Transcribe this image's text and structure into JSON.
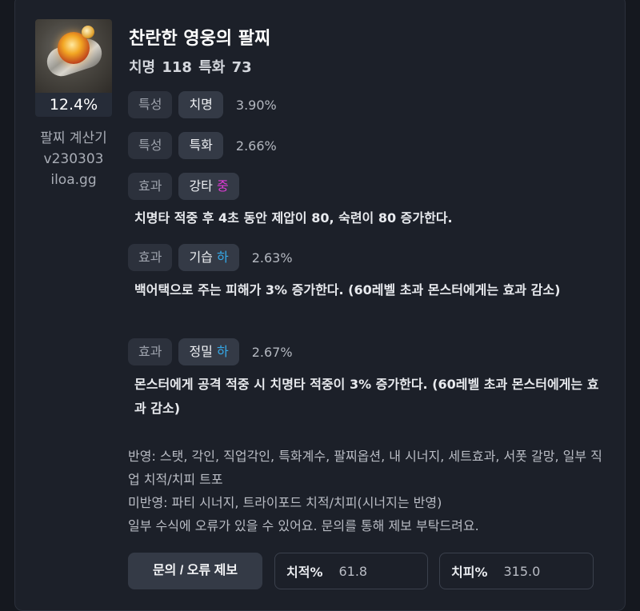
{
  "item": {
    "title": "찬란한 영웅의 팔찌",
    "stats": "치명 118  특화 73",
    "percent": "12.4%"
  },
  "calculator": {
    "line1": "팔찌 계산기",
    "line2": "v230303",
    "line3": "iloa.gg"
  },
  "rows": [
    {
      "type": "특성",
      "name": "치명",
      "grade": "",
      "value": "3.90%"
    },
    {
      "type": "특성",
      "name": "특화",
      "grade": "",
      "value": "2.66%"
    },
    {
      "type": "효과",
      "name": "강타",
      "grade": "중",
      "value": "",
      "description": "치명타 적중 후 4초 동안 제압이 80, 숙련이 80 증가한다."
    },
    {
      "type": "효과",
      "name": "기습",
      "grade": "하",
      "value": "2.63%",
      "description": "백어택으로 주는 피해가 3% 증가한다. (60레벨 초과 몬스터에게는 효과 감소)"
    },
    {
      "type": "효과",
      "name": "정밀",
      "grade": "하",
      "value": "2.67%",
      "description": "몬스터에게 공격 적중 시 치명타 적중이 3% 증가한다. (60레벨 초과 몬스터에게는 효과 감소)"
    }
  ],
  "notes": {
    "reflected": "반영: 스탯, 각인, 직업각인, 특화계수, 팔찌옵션, 내 시너지, 세트효과, 서폿 갈망, 일부 직업 치적/치피 트포",
    "not_reflected": "미반영: 파티 시너지, 트라이포드 치적/치피(시너지는 반영)",
    "disclaimer": "일부 수식에 오류가 있을 수 있어요. 문의를 통해 제보 부탁드려요."
  },
  "footer": {
    "report_button": "문의 / 오류 제보",
    "crit_rate_label": "치적%",
    "crit_rate_value": "61.8",
    "crit_dmg_label": "치피%",
    "crit_dmg_value": "315.0"
  },
  "colors": {
    "grade_mid": "#e03bd7",
    "grade_low": "#35a9e8",
    "background": "#1c2029"
  },
  "icons": {
    "item": "bracelet-icon"
  }
}
